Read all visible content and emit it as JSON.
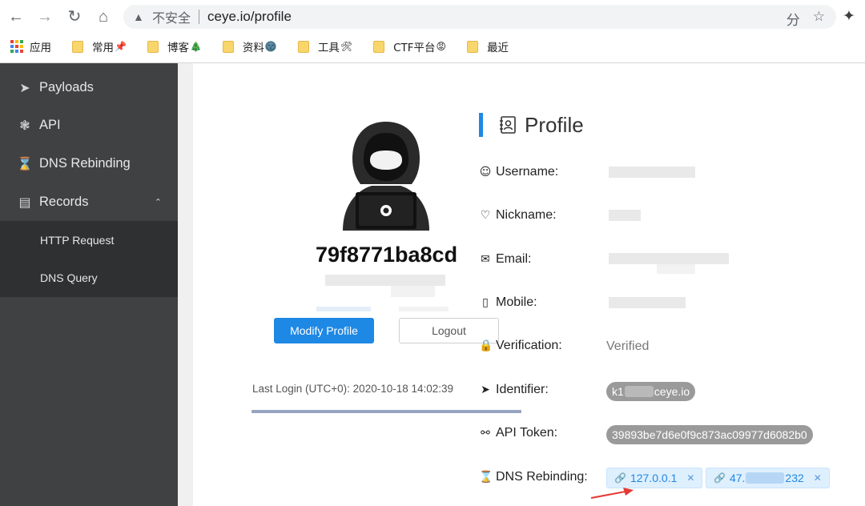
{
  "browser": {
    "security_label": "不安全",
    "url": "ceye.io/profile",
    "bookmarks": [
      {
        "label": "应用",
        "emoji": ""
      },
      {
        "label": "常用",
        "emoji": "📌"
      },
      {
        "label": "博客",
        "emoji": "🎄"
      },
      {
        "label": "资料",
        "emoji": "🌚"
      },
      {
        "label": "工具",
        "emoji": "🛠"
      },
      {
        "label": "CTF平台",
        "emoji": "😡"
      },
      {
        "label": "最近",
        "emoji": ""
      }
    ]
  },
  "sidebar": {
    "items": [
      {
        "label": "Payloads",
        "icon": "rocket-icon"
      },
      {
        "label": "API",
        "icon": "api-icon"
      },
      {
        "label": "DNS Rebinding",
        "icon": "hourglass-icon"
      },
      {
        "label": "Records",
        "icon": "records-icon"
      }
    ],
    "sub_items": [
      {
        "label": "HTTP Request"
      },
      {
        "label": "DNS Query"
      }
    ]
  },
  "user": {
    "id": "79f8771ba8cd",
    "modify_label": "Modify Profile",
    "logout_label": "Logout",
    "last_login": "Last Login (UTC+0): 2020-10-18 14:02:39"
  },
  "profile": {
    "title": "Profile",
    "fields": [
      {
        "label": "Username:",
        "icon": "user-icon"
      },
      {
        "label": "Nickname:",
        "icon": "heart-icon"
      },
      {
        "label": "Email:",
        "icon": "mail-icon"
      },
      {
        "label": "Mobile:",
        "icon": "phone-icon"
      },
      {
        "label": "Verification:",
        "icon": "lock-icon",
        "value": "Verified"
      },
      {
        "label": "Identifier:",
        "icon": "rocket-icon",
        "value_prefix": "k1",
        "value_suffix": "ceye.io"
      },
      {
        "label": "API Token:",
        "icon": "key-icon",
        "value": "39893be7d6e0f9c873ac09977d6082b0"
      },
      {
        "label": "DNS Rebinding:",
        "icon": "hourglass-icon"
      }
    ],
    "dns_rebinding": [
      {
        "ip": "127.0.0.1"
      },
      {
        "prefix": "47.",
        "suffix": "232"
      }
    ]
  },
  "colors": {
    "accent": "#1e88e5",
    "sidebar": "#404142",
    "sidebar_sub": "#2f3031"
  }
}
